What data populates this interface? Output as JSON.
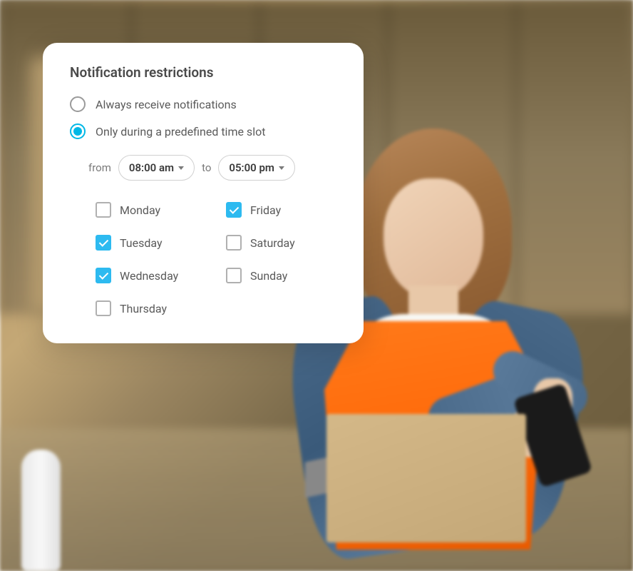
{
  "card": {
    "title": "Notification restrictions",
    "options": {
      "always": {
        "label": "Always receive notifications",
        "selected": false
      },
      "timeslot": {
        "label": "Only during a predefined time slot",
        "selected": true
      }
    },
    "time": {
      "from_label": "from",
      "from_value": "08:00 am",
      "to_label": "to",
      "to_value": "05:00 pm"
    },
    "days": [
      {
        "label": "Monday",
        "checked": false
      },
      {
        "label": "Friday",
        "checked": true
      },
      {
        "label": "Tuesday",
        "checked": true
      },
      {
        "label": "Saturday",
        "checked": false
      },
      {
        "label": "Wednesday",
        "checked": true
      },
      {
        "label": "Sunday",
        "checked": false
      },
      {
        "label": "Thursday",
        "checked": false
      }
    ]
  },
  "colors": {
    "accent": "#00b8e6",
    "checkbox": "#2dbaf0"
  }
}
